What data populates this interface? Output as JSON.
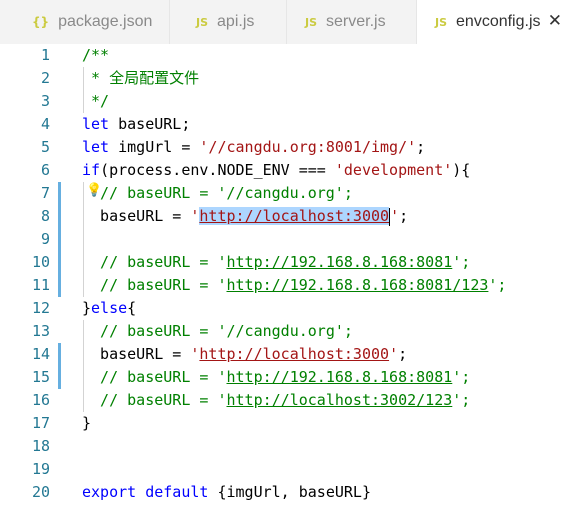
{
  "tabs": [
    {
      "icon": "{}",
      "label": "package.json"
    },
    {
      "icon": "JS",
      "label": "api.js"
    },
    {
      "icon": "JS",
      "label": "server.js"
    },
    {
      "icon": "JS",
      "label": "envconfig.js",
      "close": "✕"
    }
  ],
  "lines": [
    {
      "n": "1",
      "t": [
        "/**"
      ]
    },
    {
      "n": "2",
      "t": [
        " * 全局配置文件"
      ]
    },
    {
      "n": "3",
      "t": [
        " */"
      ]
    },
    {
      "n": "4",
      "t": [
        "let",
        " baseURL;"
      ]
    },
    {
      "n": "5",
      "t": [
        "let",
        " imgUrl = ",
        "'//cangdu.org:8001/img/'",
        ";"
      ]
    },
    {
      "n": "6",
      "t": [
        "if",
        "(process.env.NODE_ENV === ",
        "'development'",
        "){"
      ]
    },
    {
      "n": "7",
      "t": [
        "// baseURL = '//cangdu.org';"
      ]
    },
    {
      "n": "8",
      "t": [
        "  baseURL = ",
        "'",
        "http://localhost:3000",
        "'",
        ";"
      ]
    },
    {
      "n": "9",
      "t": []
    },
    {
      "n": "10",
      "t": [
        "  // baseURL = '",
        "http://192.168.8.168:8081",
        "';"
      ]
    },
    {
      "n": "11",
      "t": [
        "  // baseURL = '",
        "http://192.168.8.168:8081/123",
        "';"
      ]
    },
    {
      "n": "12",
      "t": [
        "}",
        "else",
        "{"
      ]
    },
    {
      "n": "13",
      "t": [
        "  // baseURL = '//cangdu.org';"
      ]
    },
    {
      "n": "14",
      "t": [
        "  baseURL = ",
        "'",
        "http://localhost:3000",
        "'",
        ";"
      ]
    },
    {
      "n": "15",
      "t": [
        "  // baseURL = '",
        "http://192.168.8.168:8081",
        "';"
      ]
    },
    {
      "n": "16",
      "t": [
        "  // baseURL = '",
        "http://localhost:3002/123",
        "';"
      ]
    },
    {
      "n": "17",
      "t": [
        "}"
      ]
    },
    {
      "n": "18",
      "t": []
    },
    {
      "n": "19",
      "t": []
    },
    {
      "n": "20",
      "t": [
        "export",
        " ",
        "default",
        " {imgUrl, baseURL}"
      ]
    }
  ]
}
